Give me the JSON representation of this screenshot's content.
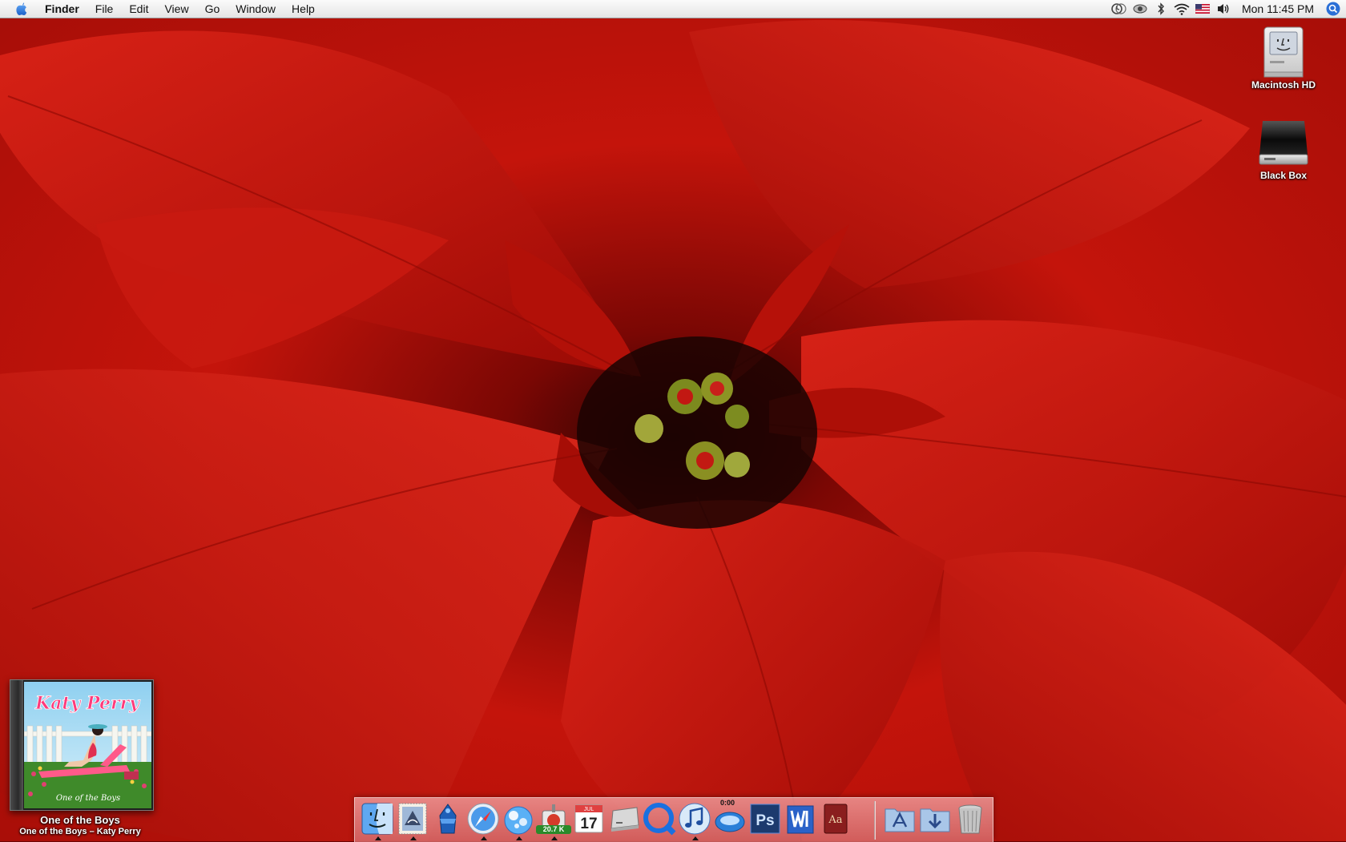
{
  "menubar": {
    "apple_icon": "apple-logo-icon",
    "app_name": "Finder",
    "menus": [
      "File",
      "Edit",
      "View",
      "Go",
      "Window",
      "Help"
    ],
    "status_icons": [
      "time-machine-icon",
      "eye-icon",
      "bluetooth-icon",
      "wifi-icon",
      "us-flag-input-icon",
      "volume-icon"
    ],
    "clock": "Mon 11:45 PM",
    "spotlight_icon": "spotlight-search-icon"
  },
  "desktop": {
    "icons": [
      {
        "label": "Macintosh HD",
        "icon": "macintosh-hd-icon"
      },
      {
        "label": "Black Box",
        "icon": "external-drive-icon"
      }
    ],
    "wallpaper": "red poinsettia"
  },
  "now_playing": {
    "album_art_text": "Katy Perry",
    "album_art_subtext": "One of the Boys",
    "title": "One of the Boys",
    "subtitle": "One of the Boys – Katy Perry"
  },
  "dock": {
    "apps": [
      {
        "name": "Finder",
        "icon": "finder-icon",
        "running": true
      },
      {
        "name": "Mail",
        "icon": "mail-stamp-icon",
        "running": true
      },
      {
        "name": "Xcode",
        "icon": "blue-helmet-icon",
        "running": false
      },
      {
        "name": "Safari",
        "icon": "safari-compass-icon",
        "running": true
      },
      {
        "name": "Bubbles",
        "icon": "blue-bubbles-icon",
        "running": true
      },
      {
        "name": "Transmission",
        "icon": "transmission-icon",
        "running": true,
        "badge": "20.7 K"
      },
      {
        "name": "iCal",
        "icon": "ical-icon",
        "running": false,
        "date_month": "JUL",
        "date_day": "17"
      },
      {
        "name": "Drive",
        "icon": "drive-icon",
        "running": false
      },
      {
        "name": "QuickTime",
        "icon": "quicktime-icon",
        "running": false
      },
      {
        "name": "iTunes",
        "icon": "itunes-icon",
        "running": true
      },
      {
        "name": "Timer",
        "icon": "timer-icon",
        "running": false,
        "mini_label": "0:00"
      },
      {
        "name": "Photoshop",
        "icon": "photoshop-icon",
        "running": false,
        "text": "Ps"
      },
      {
        "name": "Word",
        "icon": "word-icon",
        "running": false
      },
      {
        "name": "Dictionary",
        "icon": "dictionary-icon",
        "running": false,
        "text": "Aa"
      },
      {
        "name": "Applications",
        "icon": "applications-folder-icon",
        "running": false
      },
      {
        "name": "Downloads",
        "icon": "downloads-folder-icon",
        "running": false
      },
      {
        "name": "Trash",
        "icon": "trash-icon",
        "running": false
      }
    ]
  },
  "colors": {
    "wallpaper_red": "#c0140c",
    "dock_tint": "#e08a8a",
    "menubar_bg": "#ededed"
  }
}
